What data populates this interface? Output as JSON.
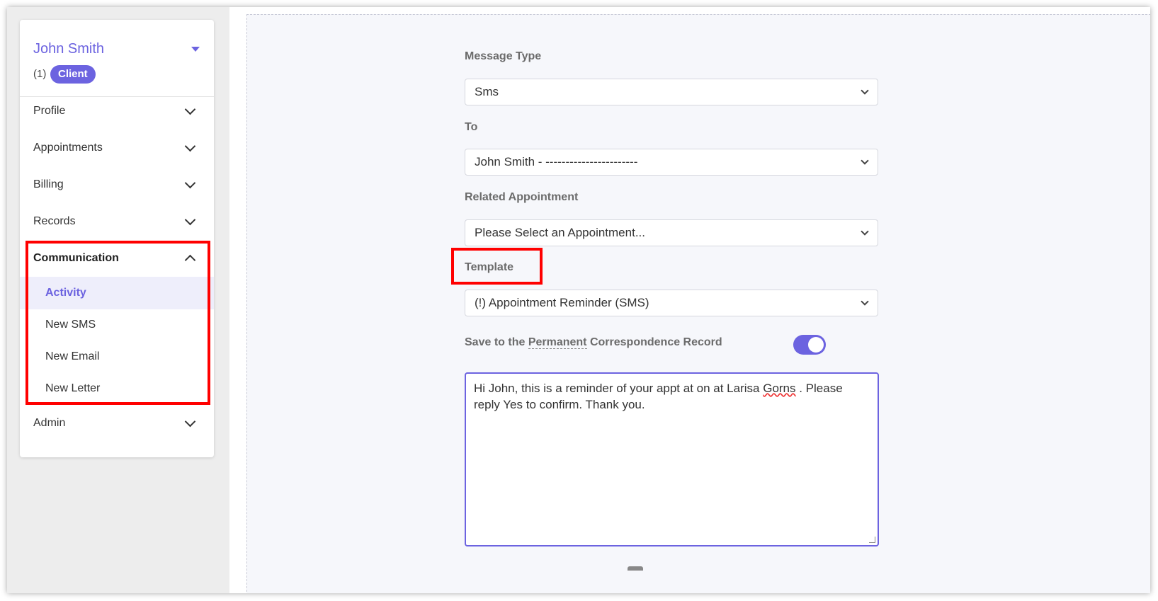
{
  "sidebar": {
    "user_name": "John Smith",
    "user_count": "(1)",
    "role_badge": "Client",
    "items": [
      {
        "label": "Profile"
      },
      {
        "label": "Appointments"
      },
      {
        "label": "Billing"
      },
      {
        "label": "Records"
      },
      {
        "label": "Communication"
      },
      {
        "label": "Admin"
      }
    ],
    "communication_sub": [
      {
        "label": "Activity"
      },
      {
        "label": "New SMS"
      },
      {
        "label": "New Email"
      },
      {
        "label": "New Letter"
      }
    ]
  },
  "form": {
    "message_type_label": "Message Type",
    "message_type_value": "Sms",
    "to_label": "To",
    "to_value": "John Smith - -----------------------",
    "related_label": "Related Appointment",
    "related_value": "Please Select an Appointment...",
    "template_label": "Template",
    "template_value": "(!) Appointment Reminder (SMS)",
    "save_prefix": "Save to the",
    "save_perm": "Permanent",
    "save_suffix": "Correspondence Record",
    "save_enabled": true,
    "message_part1": "Hi John, this is a reminder of your appt at  on  at Larisa ",
    "message_misspelled": "Gorns",
    "message_part2": " . Please reply Yes to confirm. Thank you."
  },
  "colors": {
    "accent": "#6c63e0",
    "highlight": "#ff0000"
  }
}
